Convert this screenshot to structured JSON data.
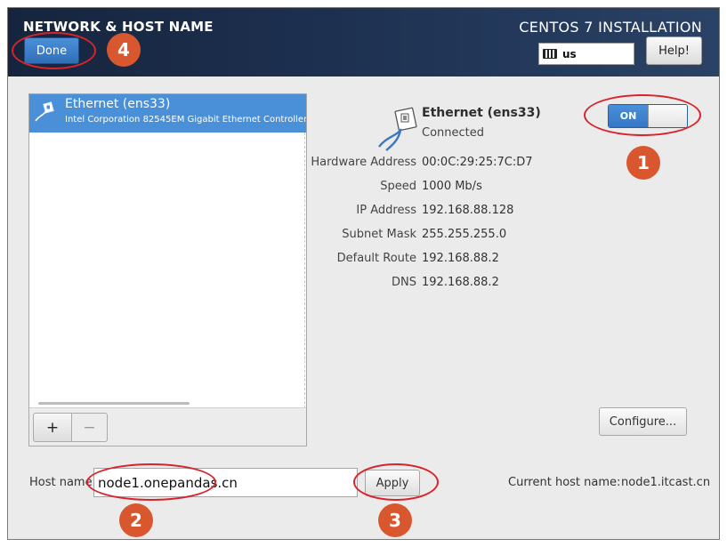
{
  "header": {
    "title": "NETWORK & HOST NAME",
    "product": "CENTOS 7 INSTALLATION",
    "done_label": "Done",
    "keyboard_layout": "us",
    "help_label": "Help!"
  },
  "device_list": {
    "items": [
      {
        "name": "Ethernet (ens33)",
        "description": "Intel Corporation 82545EM Gigabit Ethernet Controller ("
      }
    ],
    "add_label": "+",
    "remove_label": "−"
  },
  "device_detail": {
    "name": "Ethernet (ens33)",
    "status": "Connected",
    "toggle_label": "ON",
    "toggle_state": true,
    "fields": [
      {
        "label": "Hardware Address",
        "value": "00:0C:29:25:7C:D7"
      },
      {
        "label": "Speed",
        "value": "1000 Mb/s"
      },
      {
        "label": "IP Address",
        "value": "192.168.88.128"
      },
      {
        "label": "Subnet Mask",
        "value": "255.255.255.0"
      },
      {
        "label": "Default Route",
        "value": "192.168.88.2"
      },
      {
        "label": "DNS",
        "value": "192.168.88.2"
      }
    ],
    "configure_label": "Configure..."
  },
  "hostname": {
    "label": "Host name:",
    "value": "node1.onepandas.cn",
    "apply_label": "Apply",
    "current_label": "Current host name:",
    "current_value": "node1.itcast.cn"
  },
  "annotations": {
    "n1": "1",
    "n2": "2",
    "n3": "3",
    "n4": "4"
  },
  "colors": {
    "accent": "#4a90d9",
    "header_bg": "#1d3050",
    "annotation_ring": "#d9232a",
    "annotation_badge": "#d9572e"
  }
}
